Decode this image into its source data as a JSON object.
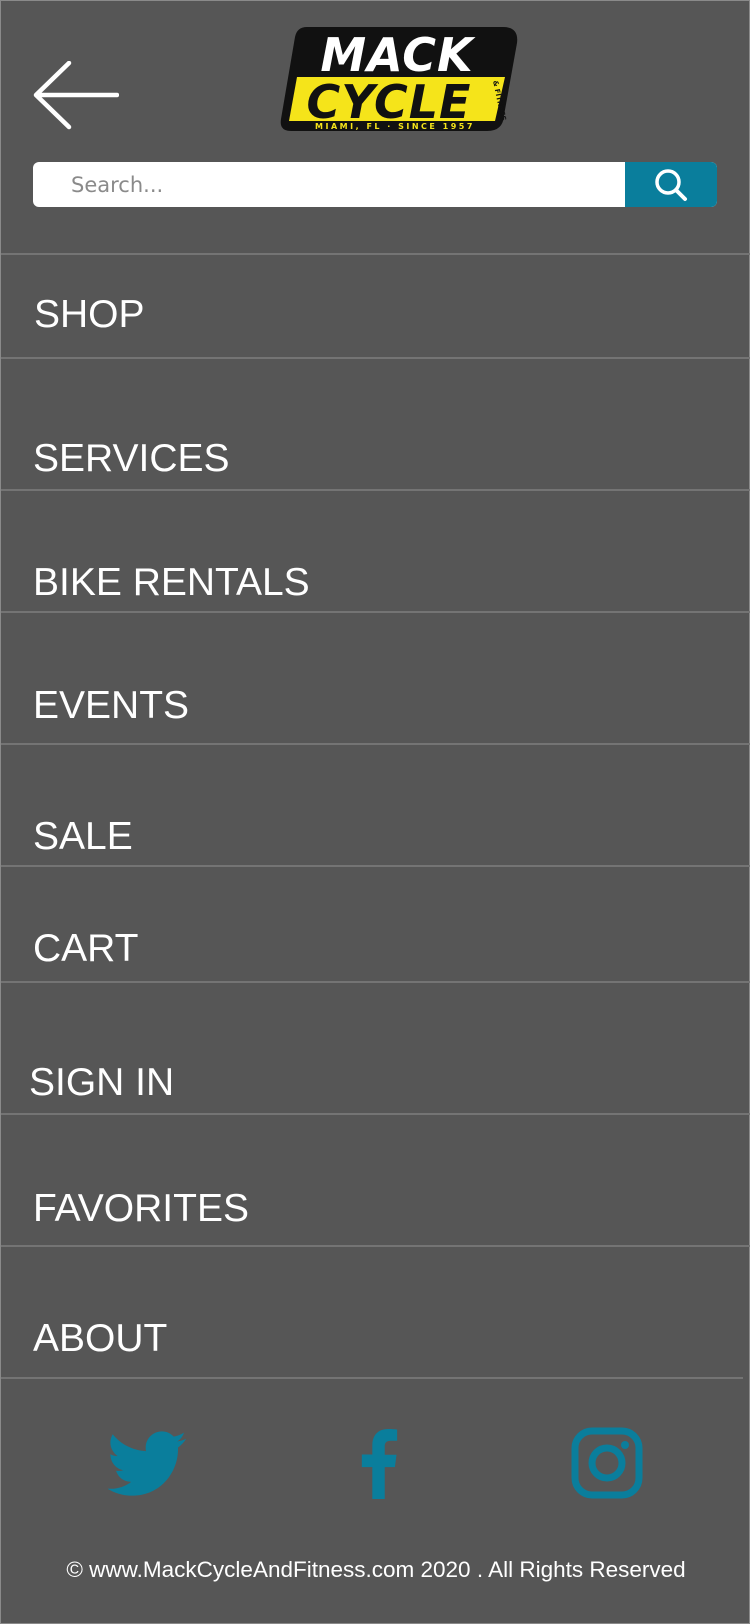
{
  "header": {
    "back_icon": "arrow-left-icon",
    "logo": {
      "line1": "MACK",
      "line2": "CYCLE",
      "side_text": "& FITNESS",
      "tagline": "MIAMI, FL · SINCE 1957"
    }
  },
  "search": {
    "placeholder": "Search...",
    "value": "",
    "button_icon": "search-icon"
  },
  "nav": {
    "items": [
      {
        "label": "SHOP"
      },
      {
        "label": "SERVICES"
      },
      {
        "label": "BIKE RENTALS"
      },
      {
        "label": "EVENTS"
      },
      {
        "label": "SALE"
      },
      {
        "label": "CART"
      },
      {
        "label": "SIGN IN"
      },
      {
        "label": "FAVORITES"
      },
      {
        "label": "ABOUT"
      }
    ]
  },
  "social": {
    "icons": [
      "twitter-icon",
      "facebook-icon",
      "instagram-icon"
    ]
  },
  "footer": {
    "text": "© www.MackCycleAndFitness.com 2020 . All Rights Reserved"
  },
  "colors": {
    "background": "#555555",
    "accent": "#0a7e9c",
    "logo_yellow": "#f5e41a",
    "text": "#ffffff"
  }
}
